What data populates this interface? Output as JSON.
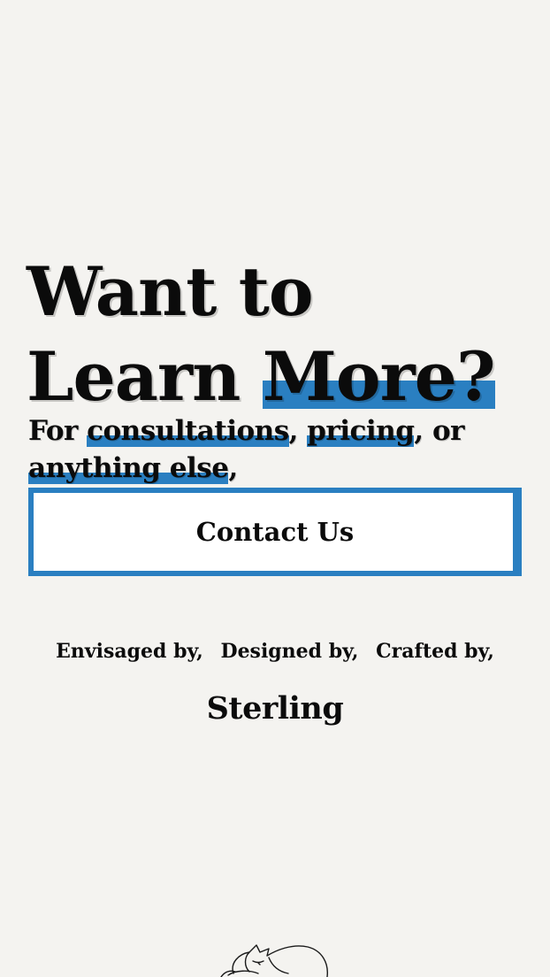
{
  "hero": {
    "line1": "Want to",
    "line2_plain": "Learn ",
    "line2_highlight": "More?"
  },
  "subtext": {
    "prefix": "For ",
    "item1": "consultations",
    "sep1": ", ",
    "item2": "pricing",
    "sep2": ", or ",
    "item3": "anything else",
    "suffix": ","
  },
  "cta": {
    "label": "Contact Us"
  },
  "credits": {
    "envisaged": "Envisaged by,",
    "designed": "Designed by,",
    "crafted": "Crafted by,",
    "name": "Sterling"
  },
  "colors": {
    "accent": "#2a7fc1",
    "background": "#f4f3f0",
    "text": "#0b0b0b"
  },
  "icons": {
    "footer_illustration": "sleeping-cat-icon"
  }
}
